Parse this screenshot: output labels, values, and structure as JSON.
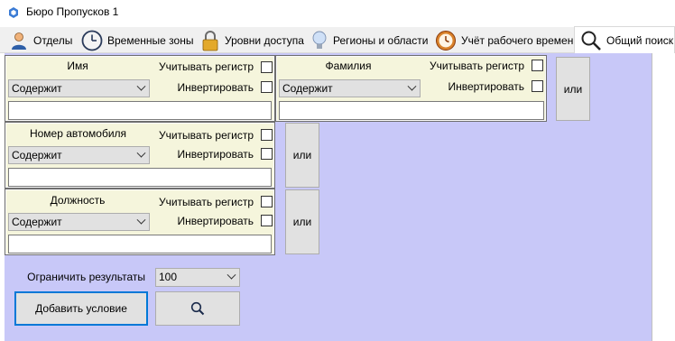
{
  "window": {
    "title": "Бюро Пропусков 1"
  },
  "tabs": [
    {
      "label": "Отделы",
      "icon": "person-icon"
    },
    {
      "label": "Временные зоны",
      "icon": "clock-icon"
    },
    {
      "label": "Уровни доступа",
      "icon": "lock-icon"
    },
    {
      "label": "Регионы и области",
      "icon": "lightbulb-icon"
    },
    {
      "label": "Учёт рабочего времени",
      "icon": "alarm-clock-icon"
    },
    {
      "label": "Общий поиск",
      "icon": "search-icon",
      "active": true
    }
  ],
  "filters": {
    "name": {
      "label": "Имя",
      "case_label": "Учитывать регистр",
      "invert_label": "Инвертировать",
      "mode": "Содержит",
      "value": ""
    },
    "surname": {
      "label": "Фамилия",
      "case_label": "Учитывать регистр",
      "invert_label": "Инвертировать",
      "mode": "Содержит",
      "value": ""
    },
    "car": {
      "label": "Номер автомобиля",
      "case_label": "Учитывать регистр",
      "invert_label": "Инвертировать",
      "mode": "Содержит",
      "value": ""
    },
    "position": {
      "label": "Должность",
      "case_label": "Учитывать регистр",
      "invert_label": "Инвертировать",
      "mode": "Содержит",
      "value": ""
    }
  },
  "or_label": "или",
  "limit": {
    "label": "Ограничить результаты",
    "value": "100"
  },
  "add_condition_label": "Добавить условие",
  "colors": {
    "panel": "#c8c8f8",
    "group": "#f5f5dc",
    "focus": "#0078d7"
  }
}
